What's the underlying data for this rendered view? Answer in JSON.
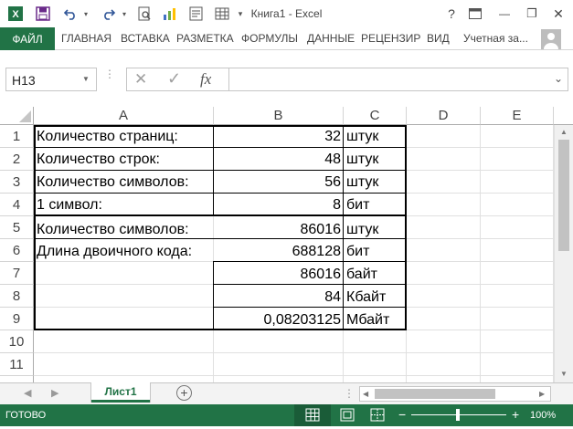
{
  "titlebar": {
    "title": "Книга1 - Excel",
    "help": "?",
    "minimize": "—",
    "restore": "❐",
    "close": "✕",
    "ribbon_options": "▣"
  },
  "ribbon": {
    "file": "ФАЙЛ",
    "tabs": [
      "ГЛАВНАЯ",
      "ВСТАВКА",
      "РАЗМЕТКА",
      "ФОРМУЛЫ",
      "ДАННЫЕ",
      "РЕЦЕНЗИР",
      "ВИД"
    ],
    "account": "Учетная за..."
  },
  "formula_bar": {
    "name_box": "H13",
    "cancel": "✕",
    "enter": "✓",
    "fx": "fx",
    "formula": ""
  },
  "columns": [
    "A",
    "B",
    "C",
    "D",
    "E"
  ],
  "rows": [
    "1",
    "2",
    "3",
    "4",
    "5",
    "6",
    "7",
    "8",
    "9",
    "10",
    "11"
  ],
  "cells": {
    "A1": "Количество страниц:",
    "B1": "32",
    "C1": "штук",
    "A2": "Количество строк:",
    "B2": "48",
    "C2": "штук",
    "A3": "Количество символов:",
    "B3": "56",
    "C3": "штук",
    "A4": "1 символ:",
    "B4": "8",
    "C4": "бит",
    "A5": "Количество символов:",
    "B5": "86016",
    "C5": "штук",
    "A6": "Длина двоичного кода:",
    "B6": "688128",
    "C6": "бит",
    "B7": "86016",
    "C7": "байт",
    "B8": "84",
    "C8": "Кбайт",
    "B9": "0,08203125",
    "C9": "Мбайт"
  },
  "sheets": [
    "Лист1"
  ],
  "status": {
    "ready": "ГОТОВО",
    "zoom": "100%",
    "zoom_minus": "−",
    "zoom_plus": "+"
  },
  "colors": {
    "excel_green": "#217346",
    "header_gray": "#ababab"
  }
}
